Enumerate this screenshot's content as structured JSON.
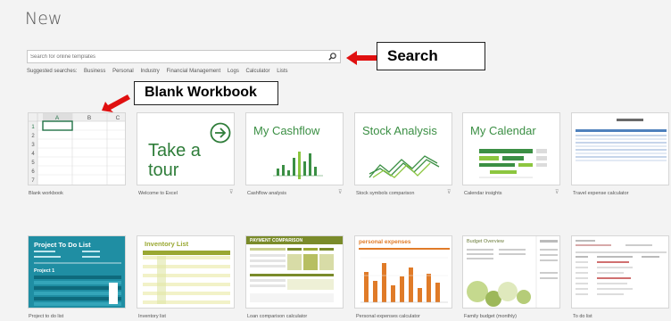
{
  "title": "New",
  "search": {
    "placeholder": "Search for online templates"
  },
  "suggested": {
    "label": "Suggested searches:",
    "items": [
      "Business",
      "Personal",
      "Industry",
      "Financial Management",
      "Logs",
      "Calculator",
      "Lists"
    ]
  },
  "callouts": {
    "search": "Search",
    "blank": "Blank Workbook"
  },
  "colors": {
    "accent_green": "#3b8f44",
    "teal": "#1f8ea3",
    "olive": "#9aa832",
    "orange": "#e07b28",
    "arrow_red": "#e01010"
  },
  "blank": {
    "cols": [
      "A",
      "B",
      "C"
    ],
    "rows": [
      "1",
      "2",
      "3",
      "4",
      "5",
      "6",
      "7"
    ]
  },
  "tiles_row1": [
    {
      "label": "Blank workbook"
    },
    {
      "label": "Welcome to Excel",
      "title_line1": "Take a",
      "title_line2": "tour"
    },
    {
      "label": "Cashflow analysis",
      "title": "My Cashflow"
    },
    {
      "label": "Stock symbols comparison",
      "title": "Stock Analysis"
    },
    {
      "label": "Calendar insights",
      "title": "My Calendar"
    },
    {
      "label": "Travel expense calculator"
    }
  ],
  "tiles_row2": [
    {
      "label": "Project to do list",
      "title": "Project To Do List",
      "subtitle": "Project 1"
    },
    {
      "label": "Inventory list",
      "title": "Inventory List"
    },
    {
      "label": "Loan comparison calculator",
      "title": "PAYMENT COMPARISON"
    },
    {
      "label": "Personal expenses calculator",
      "title": "personal expenses"
    },
    {
      "label": "Family budget (monthly)",
      "title": "Budget Overview"
    },
    {
      "label": "To do list"
    }
  ]
}
